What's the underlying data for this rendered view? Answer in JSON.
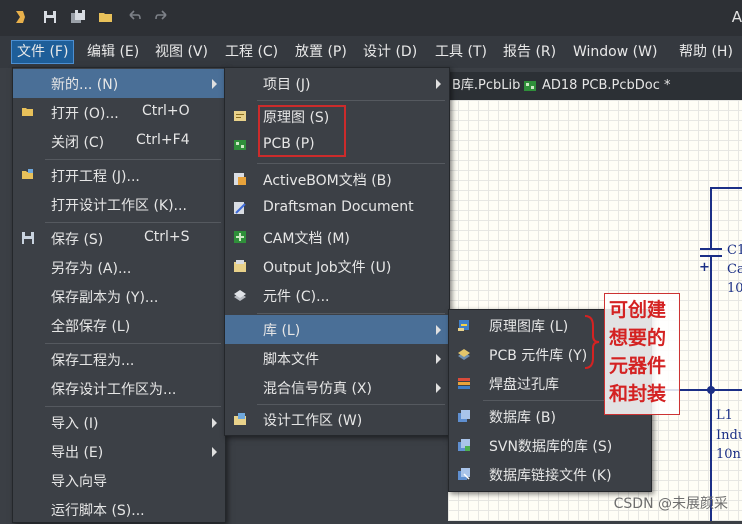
{
  "titlebar": {
    "title": "A"
  },
  "menubar": {
    "items": [
      {
        "label": "文件 (F)"
      },
      {
        "label": "编辑 (E)"
      },
      {
        "label": "视图 (V)"
      },
      {
        "label": "工程 (C)"
      },
      {
        "label": "放置 (P)"
      },
      {
        "label": "设计 (D)"
      },
      {
        "label": "工具 (T)"
      },
      {
        "label": "报告 (R)"
      },
      {
        "label": "Window (W)"
      },
      {
        "label": "帮助 (H)"
      }
    ]
  },
  "doctabs": {
    "tab1": "B库.PcbLib",
    "tab2": "AD18 PCB.PcbDoc *"
  },
  "file_menu": {
    "items": [
      {
        "label": "新的... (N)",
        "shortcut": ""
      },
      {
        "label": "打开 (O)...",
        "shortcut": "Ctrl+O"
      },
      {
        "label": "关闭 (C)",
        "shortcut": "Ctrl+F4"
      },
      {
        "label": "打开工程 (J)...",
        "shortcut": ""
      },
      {
        "label": "打开设计工作区 (K)...",
        "shortcut": ""
      },
      {
        "label": "保存 (S)",
        "shortcut": "Ctrl+S"
      },
      {
        "label": "另存为 (A)...",
        "shortcut": ""
      },
      {
        "label": "保存副本为 (Y)...",
        "shortcut": ""
      },
      {
        "label": "全部保存 (L)",
        "shortcut": ""
      },
      {
        "label": "保存工程为...",
        "shortcut": ""
      },
      {
        "label": "保存设计工作区为...",
        "shortcut": ""
      },
      {
        "label": "导入 (I)",
        "shortcut": ""
      },
      {
        "label": "导出 (E)",
        "shortcut": ""
      },
      {
        "label": "导入向导",
        "shortcut": ""
      },
      {
        "label": "运行脚本 (S)...",
        "shortcut": ""
      }
    ]
  },
  "new_menu": {
    "items": [
      {
        "label": "项目 (J)"
      },
      {
        "label": "原理图 (S)"
      },
      {
        "label": "PCB (P)"
      },
      {
        "label": "ActiveBOM文档 (B)"
      },
      {
        "label": "Draftsman Document"
      },
      {
        "label": "CAM文档 (M)"
      },
      {
        "label": "Output Job文件 (U)"
      },
      {
        "label": "元件 (C)..."
      },
      {
        "label": "库 (L)"
      },
      {
        "label": "脚本文件"
      },
      {
        "label": "混合信号仿真 (X)"
      },
      {
        "label": "设计工作区 (W)"
      }
    ]
  },
  "lib_menu": {
    "items": [
      {
        "label": "原理图库 (L)"
      },
      {
        "label": "PCB 元件库 (Y)"
      },
      {
        "label": "焊盘过孔库"
      },
      {
        "label": "数据库 (B)"
      },
      {
        "label": "SVN数据库的库 (S)"
      },
      {
        "label": "数据库链接文件 (K)"
      }
    ]
  },
  "annotation": {
    "line1": "可创建",
    "line2": "想要的",
    "line3": "元器件",
    "line4": "和封装"
  },
  "schematic": {
    "c_label": "C1",
    "c_value": "Ca",
    "c_value2": "10",
    "l_label": "L1",
    "l_value": "Indu",
    "l_value2": "10n",
    "plus": "+"
  },
  "watermark": "CSDN @未展颜采"
}
